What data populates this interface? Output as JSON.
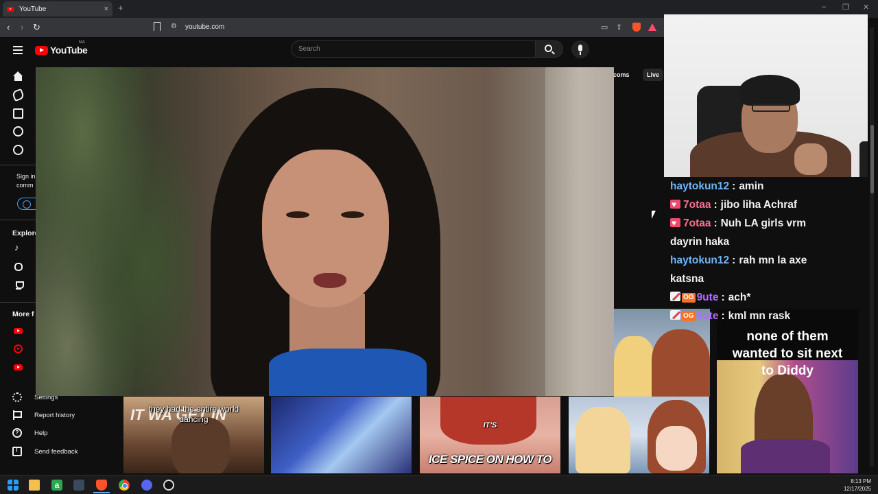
{
  "browser": {
    "tab_title": "YouTube",
    "tab_close": "×",
    "new_tab": "+",
    "url": "youtube.com",
    "nav": {
      "back": "‹",
      "forward": "›",
      "reload": "↻"
    },
    "window_controls": {
      "minimize": "–",
      "restore": "❐",
      "close": "✕"
    }
  },
  "youtube": {
    "logo_text": "YouTube",
    "region": "MA",
    "search_placeholder": "Search",
    "chips_right": [
      "coms",
      "Live"
    ],
    "sidebar": {
      "signin_text_line1": "Sign in",
      "signin_text_line2": "comm",
      "explore_heading": "Explore",
      "more_heading": "More f",
      "settings": "Settings",
      "report_history": "Report history",
      "help": "Help",
      "send_feedback": "Send feedback"
    }
  },
  "thumbnails": [
    {
      "caption": "they had the entire world dancing",
      "bg_text": "IT WA GET IN"
    },
    {
      "caption": ""
    },
    {
      "caption_top": "IT'S",
      "caption": "ICE SPICE ON HOW TO"
    },
    {
      "caption": ""
    },
    {
      "caption": "none of them wanted to sit next to Diddy"
    }
  ],
  "chat": [
    {
      "user": "haytokun12",
      "user_color": "#6fb6ff",
      "badges": [],
      "text": "amin"
    },
    {
      "user": "7otaa",
      "user_color": "#ff6f91",
      "badges": [
        "heart"
      ],
      "text": "jibo liha Achraf"
    },
    {
      "user": "7otaa",
      "user_color": "#ff6f91",
      "badges": [
        "heart"
      ],
      "text": "Nuh LA girls vrm"
    },
    {
      "user": "",
      "user_color": "#f1f1f1",
      "badges": [],
      "text": "dayrin haka"
    },
    {
      "user": "haytokun12",
      "user_color": "#6fb6ff",
      "badges": [],
      "text": "rah mn la axe"
    },
    {
      "user": "",
      "user_color": "#f1f1f1",
      "badges": [],
      "text": "katsna"
    },
    {
      "user": "9ute",
      "user_color": "#b36bff",
      "badges": [
        "sword",
        "og"
      ],
      "text": "ach*"
    },
    {
      "user": "9ute",
      "user_color": "#b36bff",
      "badges": [
        "sword",
        "og"
      ],
      "text": "kml mn rask"
    }
  ],
  "taskbar": {
    "time": "8:13 PM",
    "date": "12/17/2025"
  }
}
